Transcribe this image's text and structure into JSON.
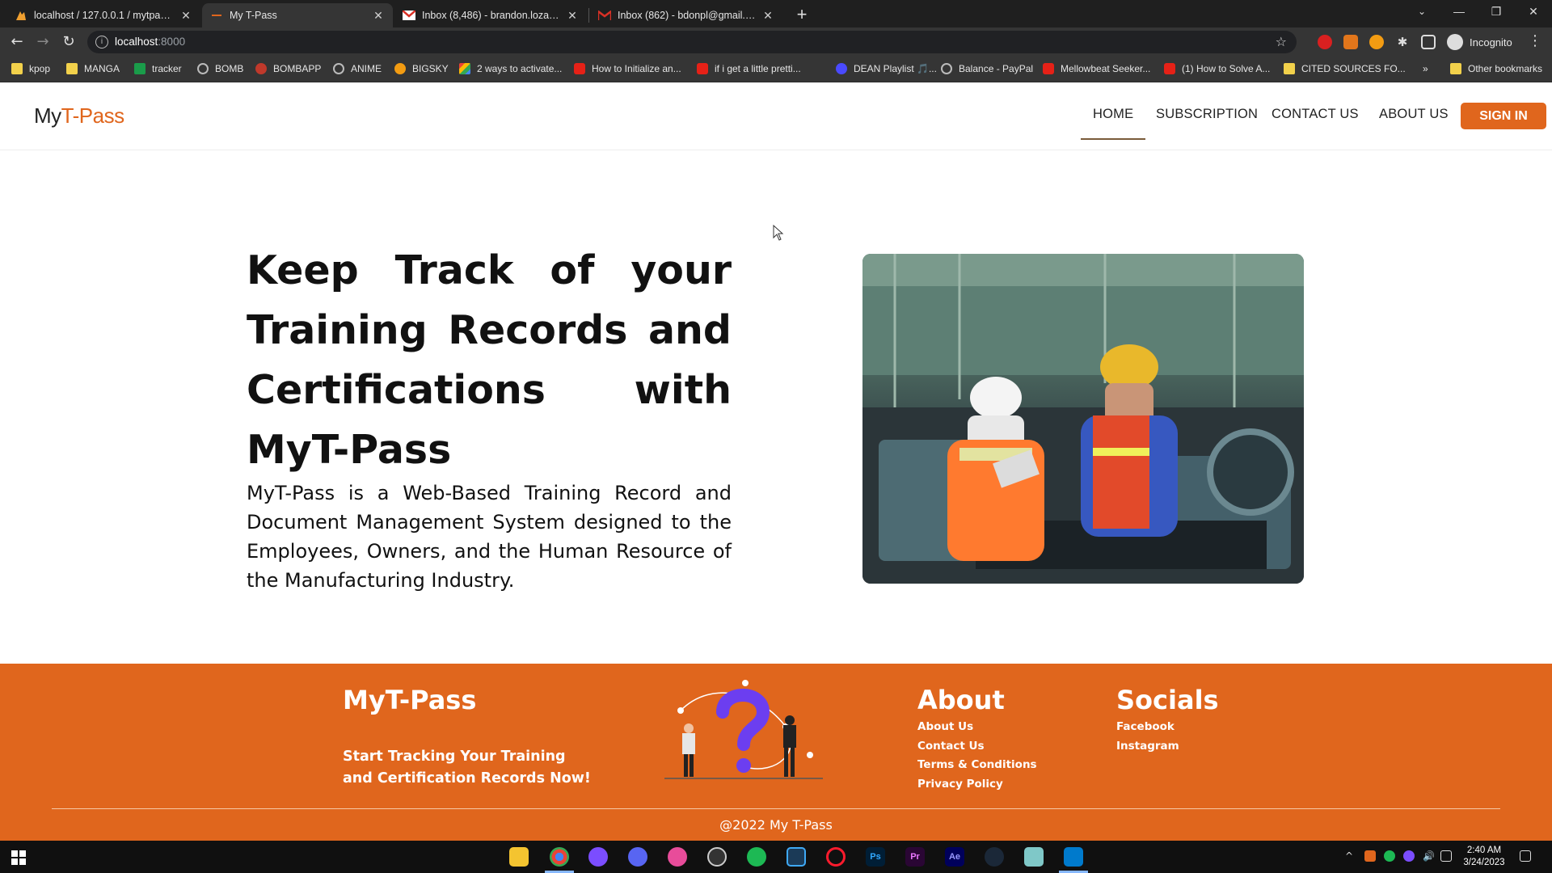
{
  "browser": {
    "tabs": [
      {
        "title": "localhost / 127.0.0.1 / mytpass / ...",
        "icon": "phpmyadmin-icon"
      },
      {
        "title": "My T-Pass",
        "icon": "site-favicon"
      },
      {
        "title": "Inbox (8,486) - brandon.lozano@...",
        "icon": "gmail-icon"
      },
      {
        "title": "Inbox (862) - bdonpl@gmail.com",
        "icon": "gmail-icon"
      }
    ],
    "new_tab": "+",
    "address": {
      "host": "localhost",
      "port": ":8000"
    },
    "profile": "Incognito",
    "bookmarks": [
      {
        "label": "kpop",
        "icon": "folder"
      },
      {
        "label": "MANGA",
        "icon": "folder"
      },
      {
        "label": "tracker",
        "icon": "green"
      },
      {
        "label": "BOMB",
        "icon": "globe"
      },
      {
        "label": "BOMBAPP",
        "icon": "red"
      },
      {
        "label": "ANIME",
        "icon": "globe"
      },
      {
        "label": "BIGSKY",
        "icon": "orange"
      },
      {
        "label": "2 ways to activate...",
        "icon": "multi"
      },
      {
        "label": "How to Initialize an...",
        "icon": "yt"
      },
      {
        "label": "if i get a little pretti...",
        "icon": "yt"
      },
      {
        "label": "DEAN Playlist 🎵...",
        "icon": "music"
      },
      {
        "label": "Balance - PayPal",
        "icon": "globe"
      },
      {
        "label": "Mellowbeat Seeker...",
        "icon": "yt"
      },
      {
        "label": "(1) How to Solve A...",
        "icon": "yt"
      },
      {
        "label": "CITED SOURCES FO...",
        "icon": "folder"
      }
    ],
    "overflow": "»",
    "other_bookmarks": "Other bookmarks"
  },
  "site": {
    "logo": {
      "part1": "My",
      "part2": "T-Pass"
    },
    "nav": [
      {
        "label": "HOME"
      },
      {
        "label": "SUBSCRIPTION"
      },
      {
        "label": "CONTACT US"
      },
      {
        "label": "ABOUT US"
      }
    ],
    "sign_in": "SIGN IN",
    "hero": {
      "title": "Keep Track of your Training Records and Certifications with MyT-Pass",
      "description": "MyT-Pass is a Web-Based Training Record and Document Management System designed to the Employees, Owners, and the Human Resource of the Manufacturing Industry."
    },
    "footer": {
      "brand": "MyT-Pass",
      "tagline_line1": "Start Tracking Your Training",
      "tagline_line2": "and Certification Records Now!",
      "about_heading": "About",
      "about_links": [
        "About Us",
        "Contact Us",
        "Terms & Conditions",
        "Privacy Policy"
      ],
      "socials_heading": "Socials",
      "social_links": [
        "Facebook",
        "Instagram"
      ],
      "copyright": "@2022 My T-Pass"
    },
    "colors": {
      "accent": "#e0661d"
    }
  },
  "taskbar": {
    "time": "2:40 AM",
    "date": "3/24/2023"
  }
}
